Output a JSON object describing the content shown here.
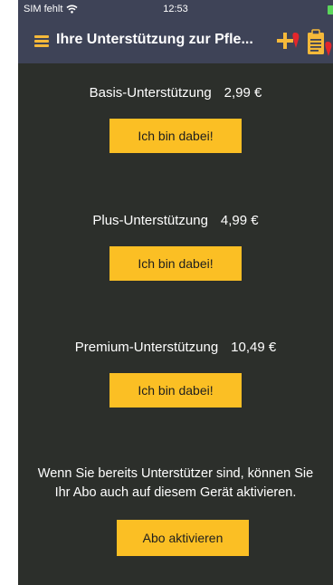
{
  "status_bar": {
    "carrier": "SIM fehlt",
    "time": "12:53"
  },
  "nav": {
    "title": "Ihre Unterstützung zur Pfle...",
    "icons": [
      "menu-icon",
      "plus-marker-icon",
      "clipboard-icon"
    ]
  },
  "tiers": [
    {
      "name": "Basis-Unterstützung",
      "price": "2,99 €",
      "button_label": "Ich bin dabei!"
    },
    {
      "name": "Plus-Unterstützung",
      "price": "4,99 €",
      "button_label": "Ich bin dabei!"
    },
    {
      "name": "Premium-Unterstützung",
      "price": "10,49 €",
      "button_label": "Ich bin dabei!"
    }
  ],
  "restore": {
    "text_line1": "Wenn Sie bereits Unterstützer sind, können Sie",
    "text_line2": "Ihr Abo auch auf diesem Gerät aktivieren.",
    "button_label": "Abo aktivieren"
  },
  "colors": {
    "background": "#2c2f2b",
    "navbar": "#3e4357",
    "accent": "#fbbf24",
    "marker_red": "#e3262b"
  }
}
